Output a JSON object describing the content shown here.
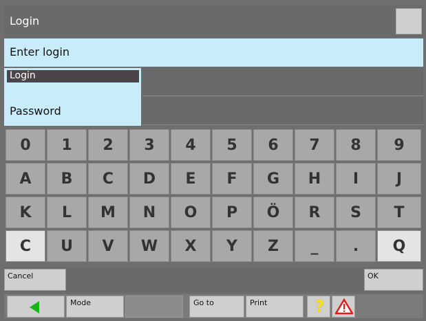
{
  "window": {
    "title": "Login"
  },
  "prompt": {
    "text": "Enter login"
  },
  "fields": {
    "login_label": "Login",
    "password_label": "Password",
    "login_value": "",
    "password_value": ""
  },
  "keyboard": {
    "rows": [
      [
        "0",
        "1",
        "2",
        "3",
        "4",
        "5",
        "6",
        "7",
        "8",
        "9"
      ],
      [
        "A",
        "B",
        "C",
        "D",
        "E",
        "F",
        "G",
        "H",
        "I",
        "J"
      ],
      [
        "K",
        "L",
        "M",
        "N",
        "O",
        "P",
        "Ö",
        "R",
        "S",
        "T"
      ],
      [
        "C",
        "U",
        "V",
        "W",
        "X",
        "Y",
        "Z",
        "_",
        ".",
        "Q"
      ]
    ]
  },
  "actions": {
    "cancel": "Cancel",
    "ok": "OK"
  },
  "footer": {
    "mode": "Mode",
    "goto": "Go to",
    "print": "Print",
    "back_icon": "green-left-arrow",
    "help_icon": "question-mark",
    "warning_icon": "warning-triangle"
  },
  "colors": {
    "field_bg": "#c9ecfb",
    "panel_bg": "#6a6a6a",
    "key_bg": "#a8a8a8",
    "key_highlight": "#e4e4e4",
    "arrow": "#18b518",
    "warning": "#e31b1b",
    "help": "#ffe600"
  }
}
